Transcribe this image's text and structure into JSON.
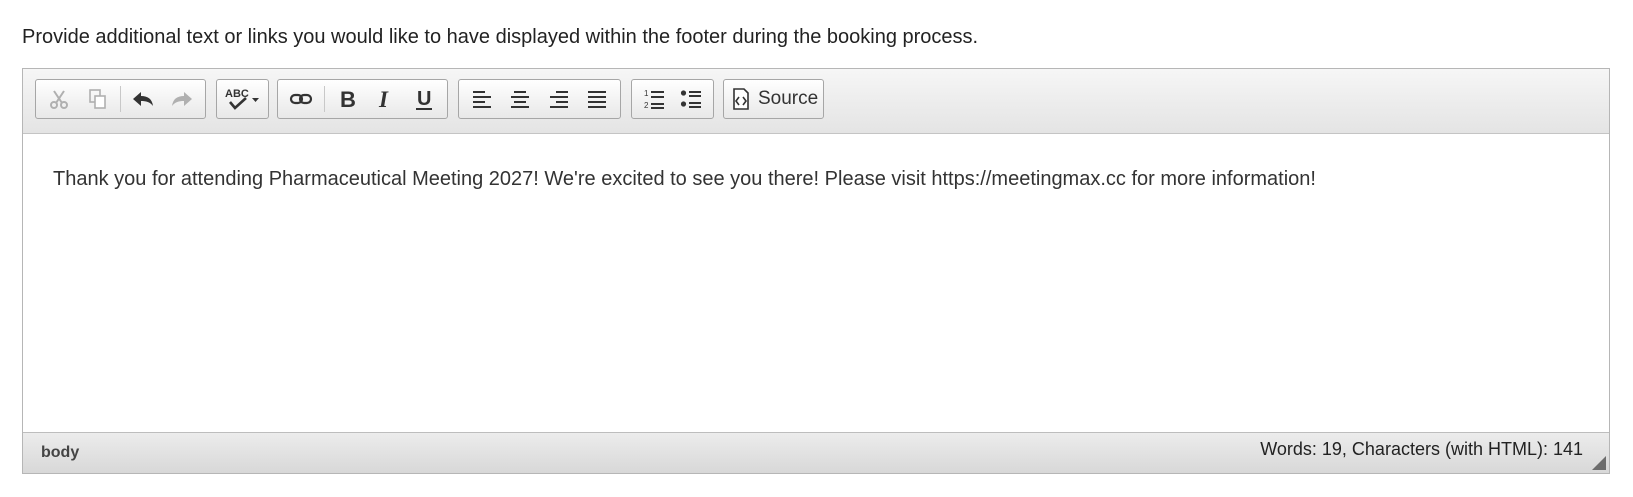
{
  "instructions": "Provide additional text or links you would like to have displayed within the footer during the booking process.",
  "toolbar": {
    "icons": [
      "cut-icon",
      "copy-icon",
      "undo-icon",
      "redo-icon",
      "spellcheck-icon",
      "link-icon",
      "bold-icon",
      "italic-icon",
      "underline-icon",
      "align-left-icon",
      "align-center-icon",
      "align-right-icon",
      "align-justify-icon",
      "numbered-list-icon",
      "bulleted-list-icon",
      "source-icon"
    ],
    "source_label": "Source"
  },
  "editor": {
    "content": "Thank you for attending Pharmaceutical Meeting 2027! We're excited to see you there! Please visit https://meetingmax.cc for more information!"
  },
  "statusbar": {
    "path": "body",
    "counter": "Words: 19, Characters (with HTML): 141"
  },
  "colors": {
    "toolbar_bg": "#e9e9e9",
    "border": "#b6b6b6",
    "icon": "#333333",
    "disabled_icon": "#b0b0b0"
  }
}
